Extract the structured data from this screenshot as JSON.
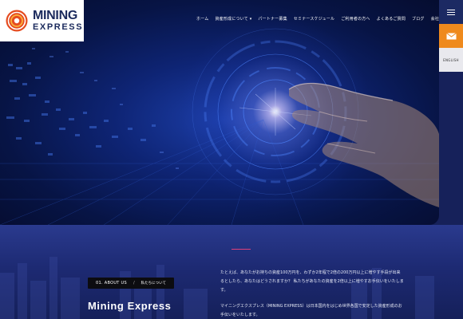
{
  "logo": {
    "line1": "MINING",
    "line2": "EXPRESS"
  },
  "nav": [
    "ホーム",
    "資産形成について ▾",
    "パートナー募集",
    "セミナースケジュール",
    "ご利用者の方へ",
    "よくあるご質問",
    "ブログ",
    "会社概要"
  ],
  "rail": {
    "menu_icon": "hamburger-icon",
    "mail_icon": "mail-icon",
    "language": "ENGLISH"
  },
  "about": {
    "breadcrumb_en": "01. ABOUT US",
    "breadcrumb_sep": "/",
    "breadcrumb_jp": "私たちについて",
    "title": "Mining Express",
    "paragraphs": [
      "たとえば、あなたがお持ちの資産100万円を、わずか2年程で2倍の200万円以上に増やす手段が出来るとしたら、あなたはどうされますか？ 私たちがあなたの資産を2倍以上に増やすお手伝いをいたします。",
      "マイニングエクスプレス（MINING EXPRESS）は日本国内をはじめ世界各国で安定した資産形成のお手伝いをいたします。"
    ]
  },
  "colors": {
    "accent_orange": "#ef8a1d",
    "brand_navy": "#1b2a5c",
    "accent_pink": "#e0417a"
  }
}
